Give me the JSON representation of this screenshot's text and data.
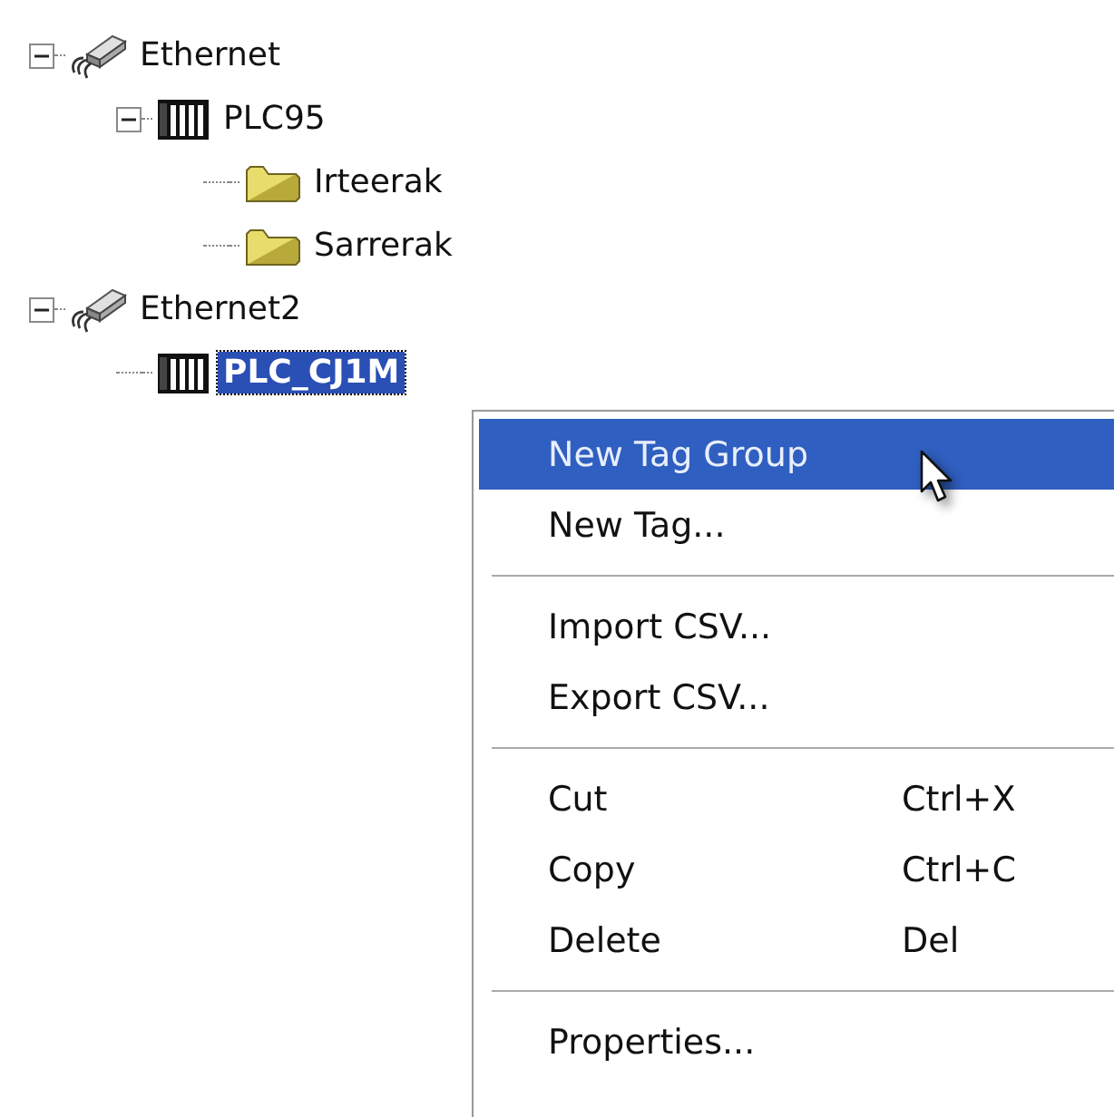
{
  "tree": [
    {
      "label": "Ethernet",
      "kind": "network",
      "expanded": true,
      "selected": false,
      "children": [
        {
          "label": "PLC95",
          "kind": "plc",
          "expanded": true,
          "selected": false,
          "children": [
            {
              "label": "Irteerak",
              "kind": "folder",
              "selected": false
            },
            {
              "label": "Sarrerak",
              "kind": "folder",
              "selected": false
            }
          ]
        }
      ]
    },
    {
      "label": "Ethernet2",
      "kind": "network",
      "expanded": true,
      "selected": false,
      "children": [
        {
          "label": "PLC_CJ1M",
          "kind": "plc",
          "selected": true
        }
      ]
    }
  ],
  "context_menu": [
    {
      "kind": "item",
      "label": "New Tag Group",
      "selected": true
    },
    {
      "kind": "item",
      "label": "New Tag...",
      "selected": false
    },
    {
      "kind": "separator"
    },
    {
      "kind": "item",
      "label": "Import CSV...",
      "selected": false
    },
    {
      "kind": "item",
      "label": "Export CSV...",
      "selected": false
    },
    {
      "kind": "separator"
    },
    {
      "kind": "item",
      "label": "Cut",
      "shortcut": "Ctrl+X",
      "selected": false
    },
    {
      "kind": "item",
      "label": "Copy",
      "shortcut": "Ctrl+C",
      "selected": false
    },
    {
      "kind": "item",
      "label": "Delete",
      "shortcut": "Del",
      "selected": false
    },
    {
      "kind": "separator"
    },
    {
      "kind": "item",
      "label": "Properties...",
      "selected": false
    }
  ]
}
